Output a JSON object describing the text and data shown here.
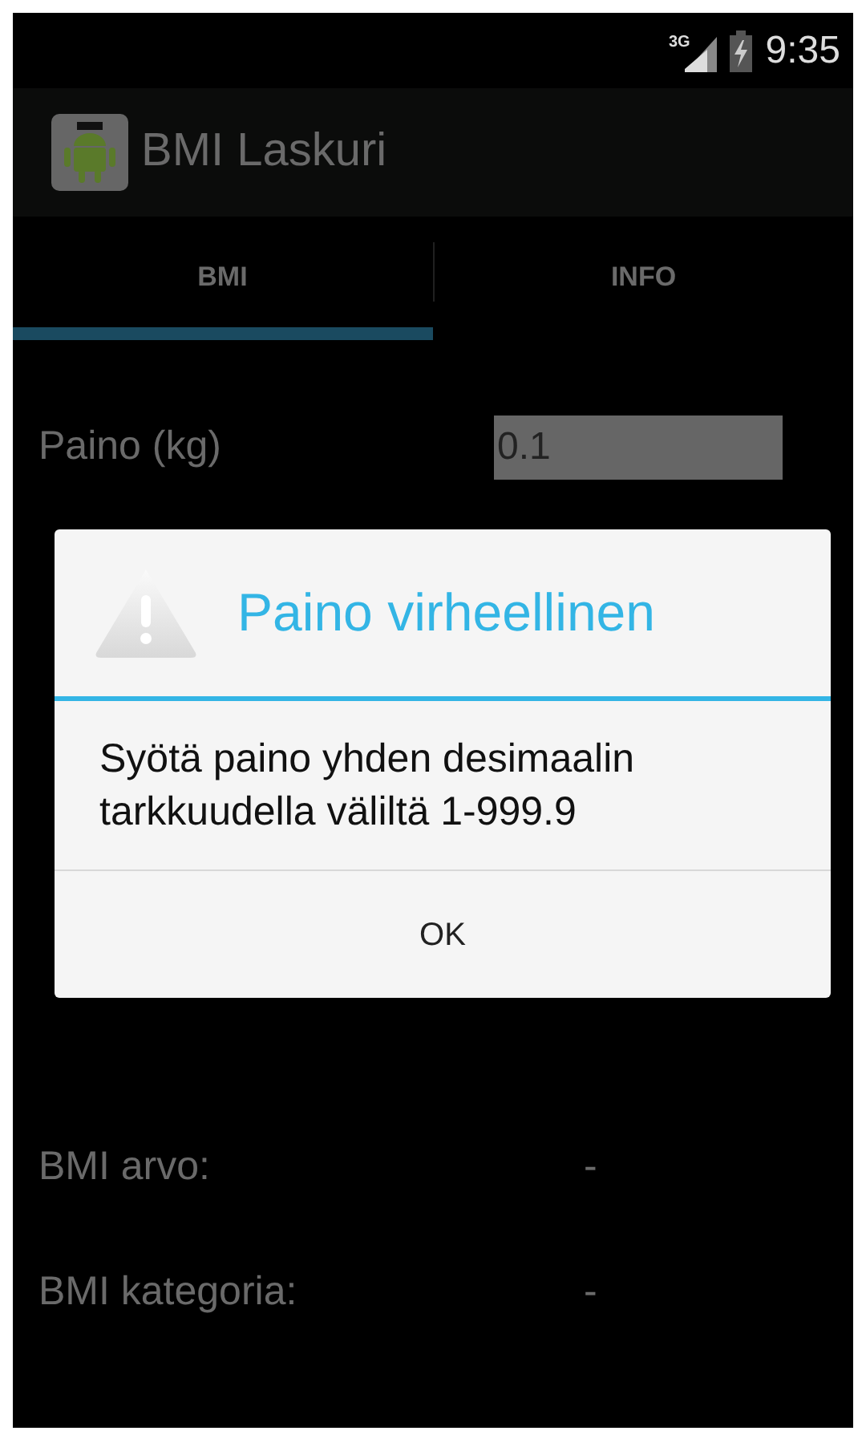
{
  "status_bar": {
    "network": "3G",
    "time": "9:35"
  },
  "app_bar": {
    "title": "BMI Laskuri"
  },
  "tabs": [
    {
      "label": "BMI",
      "selected": true
    },
    {
      "label": "INFO",
      "selected": false
    }
  ],
  "form": [
    {
      "label": "Paino (kg)",
      "value": "0.1"
    }
  ],
  "results": [
    {
      "label": "BMI arvo:",
      "value": "-"
    },
    {
      "label": "BMI kategoria:",
      "value": "-"
    }
  ],
  "dialog": {
    "title": "Paino virheellinen",
    "message": "Syötä paino yhden desimaalin tarkkuudella väliltä 1-999.9",
    "buttons": [
      "OK"
    ]
  }
}
